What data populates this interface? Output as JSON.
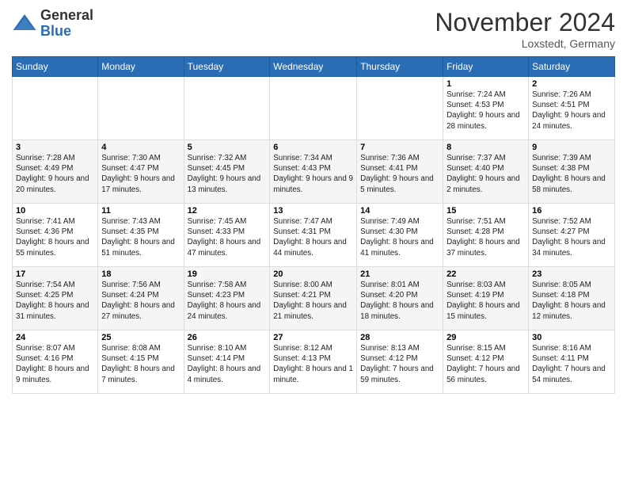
{
  "logo": {
    "general": "General",
    "blue": "Blue"
  },
  "title": "November 2024",
  "location": "Loxstedt, Germany",
  "days_of_week": [
    "Sunday",
    "Monday",
    "Tuesday",
    "Wednesday",
    "Thursday",
    "Friday",
    "Saturday"
  ],
  "weeks": [
    [
      {
        "day": "",
        "info": ""
      },
      {
        "day": "",
        "info": ""
      },
      {
        "day": "",
        "info": ""
      },
      {
        "day": "",
        "info": ""
      },
      {
        "day": "",
        "info": ""
      },
      {
        "day": "1",
        "info": "Sunrise: 7:24 AM\nSunset: 4:53 PM\nDaylight: 9 hours\nand 28 minutes."
      },
      {
        "day": "2",
        "info": "Sunrise: 7:26 AM\nSunset: 4:51 PM\nDaylight: 9 hours\nand 24 minutes."
      }
    ],
    [
      {
        "day": "3",
        "info": "Sunrise: 7:28 AM\nSunset: 4:49 PM\nDaylight: 9 hours\nand 20 minutes."
      },
      {
        "day": "4",
        "info": "Sunrise: 7:30 AM\nSunset: 4:47 PM\nDaylight: 9 hours\nand 17 minutes."
      },
      {
        "day": "5",
        "info": "Sunrise: 7:32 AM\nSunset: 4:45 PM\nDaylight: 9 hours\nand 13 minutes."
      },
      {
        "day": "6",
        "info": "Sunrise: 7:34 AM\nSunset: 4:43 PM\nDaylight: 9 hours\nand 9 minutes."
      },
      {
        "day": "7",
        "info": "Sunrise: 7:36 AM\nSunset: 4:41 PM\nDaylight: 9 hours\nand 5 minutes."
      },
      {
        "day": "8",
        "info": "Sunrise: 7:37 AM\nSunset: 4:40 PM\nDaylight: 9 hours\nand 2 minutes."
      },
      {
        "day": "9",
        "info": "Sunrise: 7:39 AM\nSunset: 4:38 PM\nDaylight: 8 hours\nand 58 minutes."
      }
    ],
    [
      {
        "day": "10",
        "info": "Sunrise: 7:41 AM\nSunset: 4:36 PM\nDaylight: 8 hours\nand 55 minutes."
      },
      {
        "day": "11",
        "info": "Sunrise: 7:43 AM\nSunset: 4:35 PM\nDaylight: 8 hours\nand 51 minutes."
      },
      {
        "day": "12",
        "info": "Sunrise: 7:45 AM\nSunset: 4:33 PM\nDaylight: 8 hours\nand 47 minutes."
      },
      {
        "day": "13",
        "info": "Sunrise: 7:47 AM\nSunset: 4:31 PM\nDaylight: 8 hours\nand 44 minutes."
      },
      {
        "day": "14",
        "info": "Sunrise: 7:49 AM\nSunset: 4:30 PM\nDaylight: 8 hours\nand 41 minutes."
      },
      {
        "day": "15",
        "info": "Sunrise: 7:51 AM\nSunset: 4:28 PM\nDaylight: 8 hours\nand 37 minutes."
      },
      {
        "day": "16",
        "info": "Sunrise: 7:52 AM\nSunset: 4:27 PM\nDaylight: 8 hours\nand 34 minutes."
      }
    ],
    [
      {
        "day": "17",
        "info": "Sunrise: 7:54 AM\nSunset: 4:25 PM\nDaylight: 8 hours\nand 31 minutes."
      },
      {
        "day": "18",
        "info": "Sunrise: 7:56 AM\nSunset: 4:24 PM\nDaylight: 8 hours\nand 27 minutes."
      },
      {
        "day": "19",
        "info": "Sunrise: 7:58 AM\nSunset: 4:23 PM\nDaylight: 8 hours\nand 24 minutes."
      },
      {
        "day": "20",
        "info": "Sunrise: 8:00 AM\nSunset: 4:21 PM\nDaylight: 8 hours\nand 21 minutes."
      },
      {
        "day": "21",
        "info": "Sunrise: 8:01 AM\nSunset: 4:20 PM\nDaylight: 8 hours\nand 18 minutes."
      },
      {
        "day": "22",
        "info": "Sunrise: 8:03 AM\nSunset: 4:19 PM\nDaylight: 8 hours\nand 15 minutes."
      },
      {
        "day": "23",
        "info": "Sunrise: 8:05 AM\nSunset: 4:18 PM\nDaylight: 8 hours\nand 12 minutes."
      }
    ],
    [
      {
        "day": "24",
        "info": "Sunrise: 8:07 AM\nSunset: 4:16 PM\nDaylight: 8 hours\nand 9 minutes."
      },
      {
        "day": "25",
        "info": "Sunrise: 8:08 AM\nSunset: 4:15 PM\nDaylight: 8 hours\nand 7 minutes."
      },
      {
        "day": "26",
        "info": "Sunrise: 8:10 AM\nSunset: 4:14 PM\nDaylight: 8 hours\nand 4 minutes."
      },
      {
        "day": "27",
        "info": "Sunrise: 8:12 AM\nSunset: 4:13 PM\nDaylight: 8 hours\nand 1 minute."
      },
      {
        "day": "28",
        "info": "Sunrise: 8:13 AM\nSunset: 4:12 PM\nDaylight: 7 hours\nand 59 minutes."
      },
      {
        "day": "29",
        "info": "Sunrise: 8:15 AM\nSunset: 4:12 PM\nDaylight: 7 hours\nand 56 minutes."
      },
      {
        "day": "30",
        "info": "Sunrise: 8:16 AM\nSunset: 4:11 PM\nDaylight: 7 hours\nand 54 minutes."
      }
    ]
  ]
}
